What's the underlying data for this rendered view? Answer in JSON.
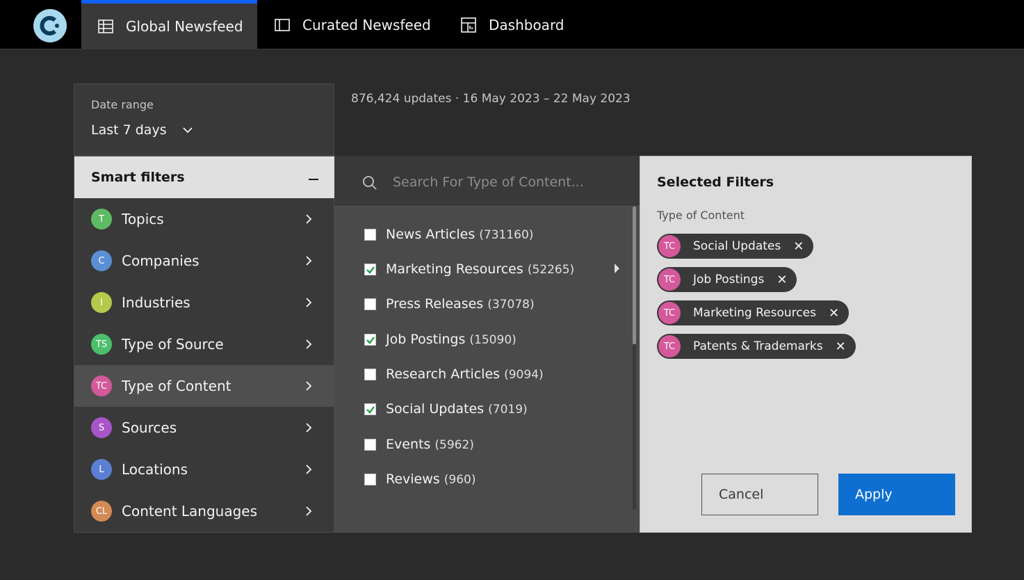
{
  "nav": {
    "tabs": [
      {
        "label": "Global Newsfeed",
        "icon": "table-icon",
        "active": true
      },
      {
        "label": "Curated Newsfeed",
        "icon": "panel-icon",
        "active": false
      },
      {
        "label": "Dashboard",
        "icon": "dashboard-icon",
        "active": false
      }
    ]
  },
  "date_range": {
    "label": "Date range",
    "value": "Last 7 days"
  },
  "summary": "876,424 updates · 16 May 2023 – 22 May 2023",
  "smart_filters": {
    "title": "Smart filters",
    "items": [
      {
        "badge": "T",
        "label": "Topics",
        "color": "#5dbb63"
      },
      {
        "badge": "C",
        "label": "Companies",
        "color": "#5b8fd4"
      },
      {
        "badge": "I",
        "label": "Industries",
        "color": "#b5c94a"
      },
      {
        "badge": "TS",
        "label": "Type of Source",
        "color": "#4bbf6b"
      },
      {
        "badge": "TC",
        "label": "Type of Content",
        "color": "#d4599a"
      },
      {
        "badge": "S",
        "label": "Sources",
        "color": "#a855c8"
      },
      {
        "badge": "L",
        "label": "Locations",
        "color": "#5b7fd4"
      },
      {
        "badge": "CL",
        "label": "Content Languages",
        "color": "#d48a55"
      }
    ]
  },
  "content_list": {
    "search_placeholder": "Search For Type of Content...",
    "items": [
      {
        "label": "News Articles",
        "count": "(731160)",
        "checked": false
      },
      {
        "label": "Marketing Resources",
        "count": "(52265)",
        "checked": true
      },
      {
        "label": "Press Releases",
        "count": "(37078)",
        "checked": false
      },
      {
        "label": "Job Postings",
        "count": "(15090)",
        "checked": true
      },
      {
        "label": "Research Articles",
        "count": "(9094)",
        "checked": false
      },
      {
        "label": "Social Updates",
        "count": "(7019)",
        "checked": true
      },
      {
        "label": "Events",
        "count": "(5962)",
        "checked": false
      },
      {
        "label": "Reviews",
        "count": "(960)",
        "checked": false
      }
    ]
  },
  "selected_filters": {
    "title": "Selected Filters",
    "group_label": "Type of Content",
    "chips": [
      {
        "badge": "TC",
        "label": "Social Updates"
      },
      {
        "badge": "TC",
        "label": "Job Postings"
      },
      {
        "badge": "TC",
        "label": "Marketing Resources"
      },
      {
        "badge": "TC",
        "label": "Patents & Trademarks"
      }
    ],
    "cancel_label": "Cancel",
    "apply_label": "Apply"
  },
  "colors": {
    "accent": "#0f62fe",
    "apply": "#0f6fd0",
    "check": "#24a148"
  }
}
